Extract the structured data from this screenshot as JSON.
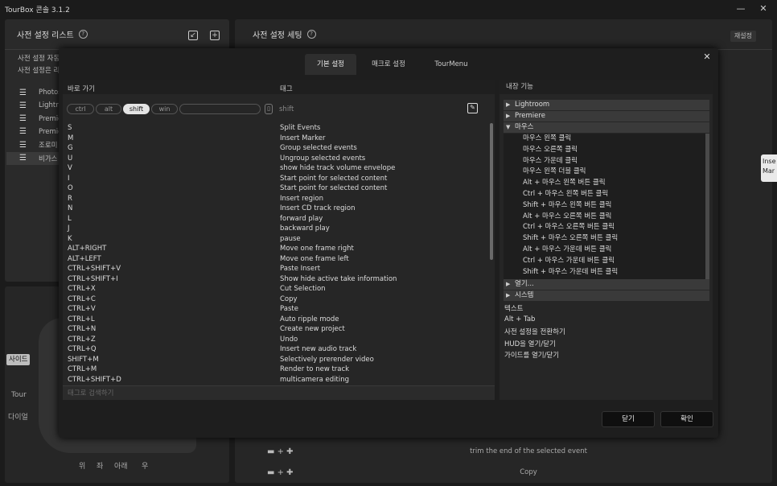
{
  "app": {
    "title": "TourBox 콘솔 3.1.2"
  },
  "left_panel": {
    "header": "사전 설정 리스트",
    "desc1": "사전 설정 자동",
    "desc2": "사전 설정은 리",
    "presets": [
      "Photos",
      "Lightro",
      "Premie",
      "Premie",
      "조로미",
      "비가스"
    ]
  },
  "device": {
    "side_label": "사이드",
    "tour_label": "Tour",
    "dial_label": "다이얼",
    "dir_labels": [
      "위",
      "좌",
      "아래",
      "우"
    ]
  },
  "right_panel": {
    "header": "사전 설정 세팅",
    "reset_label": "재설정",
    "bottom_rows": [
      "trim the end of the selected event",
      "Copy"
    ],
    "tooltip_line1": "Inse",
    "tooltip_line2": "Mar"
  },
  "modal": {
    "tabs": [
      "기본 설정",
      "매크로 설정",
      "TourMenu"
    ],
    "active_tab": 0,
    "shortcut_header": "바로 가기",
    "tag_header": "태그",
    "modifiers": [
      "ctrl",
      "alt",
      "shift",
      "win"
    ],
    "active_modifier": "shift",
    "tag_value": "shift",
    "search_placeholder": "태그로 검색하기",
    "shortcuts": [
      {
        "key": "S",
        "tag": "Split Events"
      },
      {
        "key": "M",
        "tag": "Insert Marker"
      },
      {
        "key": "G",
        "tag": "Group selected events"
      },
      {
        "key": "U",
        "tag": "Ungroup selected events"
      },
      {
        "key": "V",
        "tag": "show hide track volume envelope"
      },
      {
        "key": "I",
        "tag": "Start point for selected content"
      },
      {
        "key": "O",
        "tag": "Start point for selected content"
      },
      {
        "key": "R",
        "tag": "Insert region"
      },
      {
        "key": "N",
        "tag": "Insert CD track region"
      },
      {
        "key": "L",
        "tag": "forward play"
      },
      {
        "key": "J",
        "tag": "backward play"
      },
      {
        "key": "K",
        "tag": "pause"
      },
      {
        "key": "ALT+RIGHT",
        "tag": "Move one frame right"
      },
      {
        "key": "ALT+LEFT",
        "tag": "Move one frame left"
      },
      {
        "key": "CTRL+SHIFT+V",
        "tag": "Paste Insert"
      },
      {
        "key": "CTRL+SHIFT+I",
        "tag": "Show hide active take information"
      },
      {
        "key": "CTRL+X",
        "tag": "Cut Selection"
      },
      {
        "key": "CTRL+C",
        "tag": "Copy"
      },
      {
        "key": "CTRL+V",
        "tag": "Paste"
      },
      {
        "key": "CTRL+L",
        "tag": "Auto ripple mode"
      },
      {
        "key": "CTRL+N",
        "tag": "Create new project"
      },
      {
        "key": "CTRL+Z",
        "tag": "Undo"
      },
      {
        "key": "CTRL+Q",
        "tag": "Insert new audio track"
      },
      {
        "key": "SHIFT+M",
        "tag": "Selectively prerender video"
      },
      {
        "key": "CTRL+M",
        "tag": "Render to new track"
      },
      {
        "key": "CTRL+SHIFT+D",
        "tag": "multicamera editing"
      }
    ],
    "builtin_header": "내장 기능",
    "categories_top": [
      "Lightroom",
      "Premiere",
      "마우스"
    ],
    "mouse_items": [
      "마우스 왼쪽 클릭",
      "마우스 오른쪽 클릭",
      "마우스 가운데 클릭",
      "마우스 왼쪽 더블 클릭",
      "Alt + 마우스 왼쪽 버튼 클릭",
      "Ctrl + 마우스 왼쪽 버튼 클릭",
      "Shift +  마우스 왼쪽 버튼 클릭",
      "Alt + 마우스 오른쪽 버튼 클릭",
      "Ctrl + 마우스 오른쪽 버튼 클릭",
      "Shift + 마우스 오른쪽 버튼 클릭",
      "Alt + 마우스 가운데 버튼 클릭",
      "Ctrl + 마우스 가운데 버튼 클릭",
      "Shift + 마우스 가운데 버튼 클릭"
    ],
    "categories_bottom": [
      "열기...",
      "시스템"
    ],
    "plain_items": [
      "텍스트",
      "Alt + Tab",
      "사전 설정을 전환하기",
      "HUD을 열기/닫기",
      "가이드를 열기/닫기"
    ],
    "close_label": "닫기",
    "confirm_label": "확인"
  }
}
